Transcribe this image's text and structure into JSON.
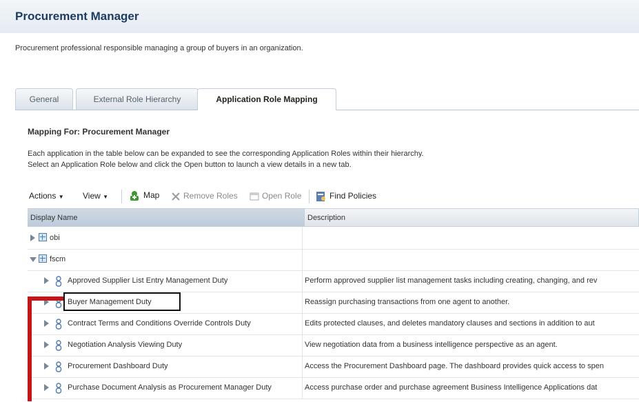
{
  "page": {
    "title": "Procurement Manager",
    "description": "Procurement professional responsible managing a group of buyers in an organization."
  },
  "tabs": [
    {
      "label": "General",
      "active": false
    },
    {
      "label": "External Role Hierarchy",
      "active": false
    },
    {
      "label": "Application Role Mapping",
      "active": true
    }
  ],
  "mapping": {
    "title": "Mapping For: Procurement Manager",
    "instructions_line1": "Each application in the table below can be expanded to see the corresponding Application Roles within their hierarchy.",
    "instructions_line2": "Select an Application Role below and click the Open button to launch a view details in a new tab."
  },
  "toolbar": {
    "actions_label": "Actions",
    "view_label": "View",
    "map_label": "Map",
    "remove_roles_label": "Remove Roles",
    "open_role_label": "Open Role",
    "find_policies_label": "Find Policies"
  },
  "table": {
    "columns": [
      "Display Name",
      "Description"
    ],
    "rows": [
      {
        "name": "obi",
        "description": "",
        "type": "application",
        "state": "collapsed"
      },
      {
        "name": "fscm",
        "description": "",
        "type": "application",
        "state": "expanded"
      },
      {
        "name": "Approved Supplier List Entry Management Duty",
        "description": "Perform approved supplier list management tasks including creating, changing, and rev",
        "type": "role"
      },
      {
        "name": "Buyer Management Duty",
        "description": "Reassign purchasing transactions from one agent to another.",
        "type": "role",
        "highlighted": true
      },
      {
        "name": "Contract Terms and Conditions Override Controls Duty",
        "description": "Edits protected clauses, and deletes mandatory clauses and sections in addition to aut",
        "type": "role"
      },
      {
        "name": "Negotiation Analysis Viewing Duty",
        "description": "View negotiation data from a business intelligence perspective as an agent.",
        "type": "role"
      },
      {
        "name": "Procurement Dashboard Duty",
        "description": "Access the Procurement Dashboard page. The dashboard provides quick access to spen",
        "type": "role"
      },
      {
        "name": "Purchase Document Analysis as Procurement Manager Duty",
        "description": "Access purchase order and purchase agreement Business Intelligence Applications dat",
        "type": "role"
      }
    ]
  },
  "icons": {
    "map": "map-add-icon",
    "remove": "remove-roles-icon",
    "open": "open-role-icon",
    "find": "find-policies-icon",
    "role": "application-role-icon",
    "app": "application-folder-icon"
  },
  "colors": {
    "title": "#1e3c62",
    "annotation_red": "#c01818",
    "map_green": "#3a9a2f"
  }
}
